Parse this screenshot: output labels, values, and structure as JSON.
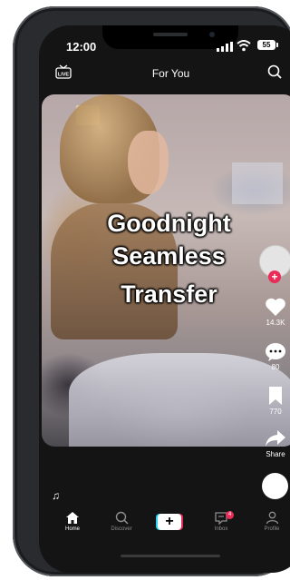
{
  "status_bar": {
    "time": "12:00",
    "battery": "55"
  },
  "header": {
    "title": "For You",
    "live_icon_label": "LIVE"
  },
  "video": {
    "overlay_lines": [
      "Goodnight",
      "Seamless",
      "Transfer"
    ]
  },
  "actions": {
    "likes": "14.3K",
    "comments": "80",
    "saves": "770",
    "share_label": "Share"
  },
  "music_note": "♫",
  "tabs": [
    {
      "label": "Home"
    },
    {
      "label": "Discover"
    },
    {
      "label": "+"
    },
    {
      "label": "Inbox",
      "badge": "4"
    },
    {
      "label": "Profile"
    }
  ],
  "colors": {
    "accent_red": "#ea2c59",
    "accent_cyan": "#20d5ec"
  }
}
